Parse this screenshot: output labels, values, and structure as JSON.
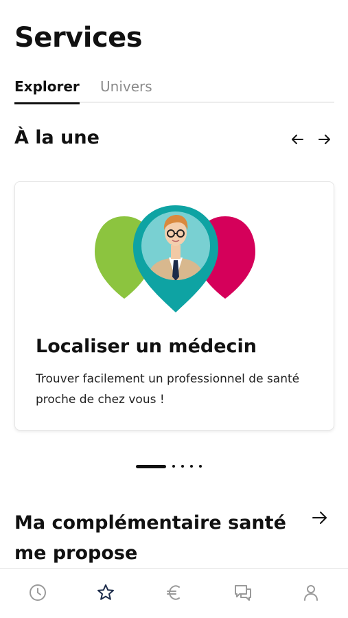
{
  "header": {
    "title": "Services"
  },
  "tabs": [
    {
      "label": "Explorer",
      "active": true
    },
    {
      "label": "Univers",
      "active": false
    }
  ],
  "featured": {
    "title": "À la une",
    "prev_icon": "arrow-left-icon",
    "next_icon": "arrow-right-icon",
    "card": {
      "illustration": "doctor-location-pins-illustration",
      "title": "Localiser un médecin",
      "description": "Trouver facilement un professionnel de santé proche de chez vous !"
    },
    "pager": {
      "total": 5,
      "active_index": 0
    }
  },
  "section2": {
    "title": "Ma complémentaire santé me propose",
    "icon": "arrow-right-icon"
  },
  "bottom_nav": [
    {
      "icon": "clock-icon",
      "active": false
    },
    {
      "icon": "star-icon",
      "active": true
    },
    {
      "icon": "euro-icon",
      "active": false
    },
    {
      "icon": "chat-icon",
      "active": false
    },
    {
      "icon": "user-icon",
      "active": false
    }
  ],
  "colors": {
    "text": "#111111",
    "tab_inactive": "#8a8a8a",
    "nav_icon": "#9a9a9a",
    "nav_active": "#1c2b4a",
    "pin_green": "#8cc43f",
    "pin_teal": "#0ea3a3",
    "pin_red": "#d5005a"
  }
}
